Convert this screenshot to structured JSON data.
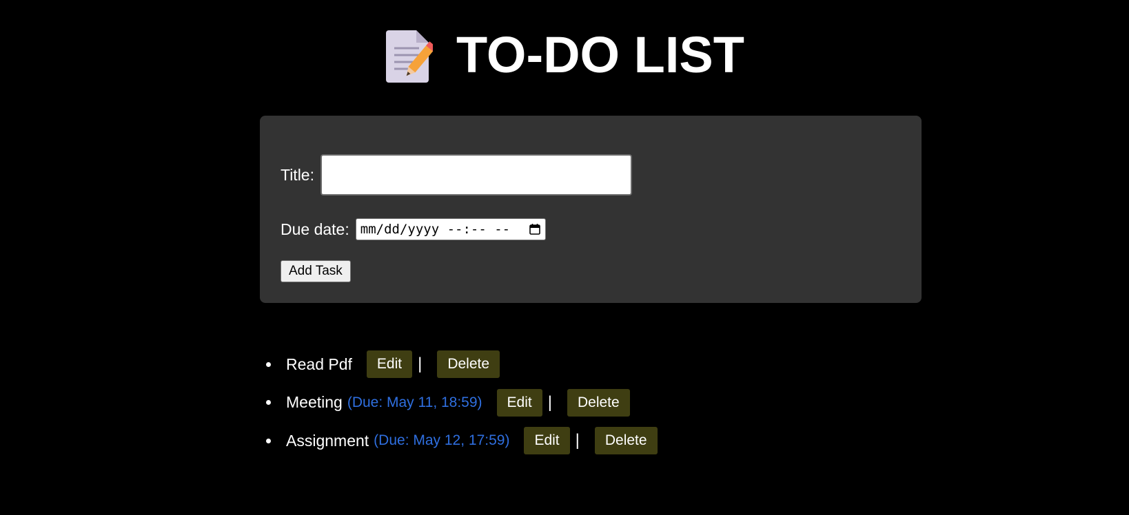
{
  "header": {
    "title": "TO-DO LIST",
    "icon": "memo-document-pencil-icon"
  },
  "form": {
    "title_label": "Title:",
    "title_value": "",
    "due_label": "Due date:",
    "due_placeholder": "mm/dd/yyyy --:-- --",
    "add_button": "Add Task"
  },
  "tasks": [
    {
      "title": "Read Pdf",
      "due": "",
      "edit_label": "Edit",
      "separator": "|",
      "delete_label": "Delete"
    },
    {
      "title": "Meeting",
      "due": "(Due: May 11, 18:59)",
      "edit_label": "Edit",
      "separator": "|",
      "delete_label": "Delete"
    },
    {
      "title": "Assignment",
      "due": "(Due: May 12, 17:59)",
      "edit_label": "Edit",
      "separator": "|",
      "delete_label": "Delete"
    }
  ],
  "colors": {
    "background": "#000000",
    "panel": "#333333",
    "button": "#3f3e12",
    "due_text": "#2f6fe0"
  }
}
